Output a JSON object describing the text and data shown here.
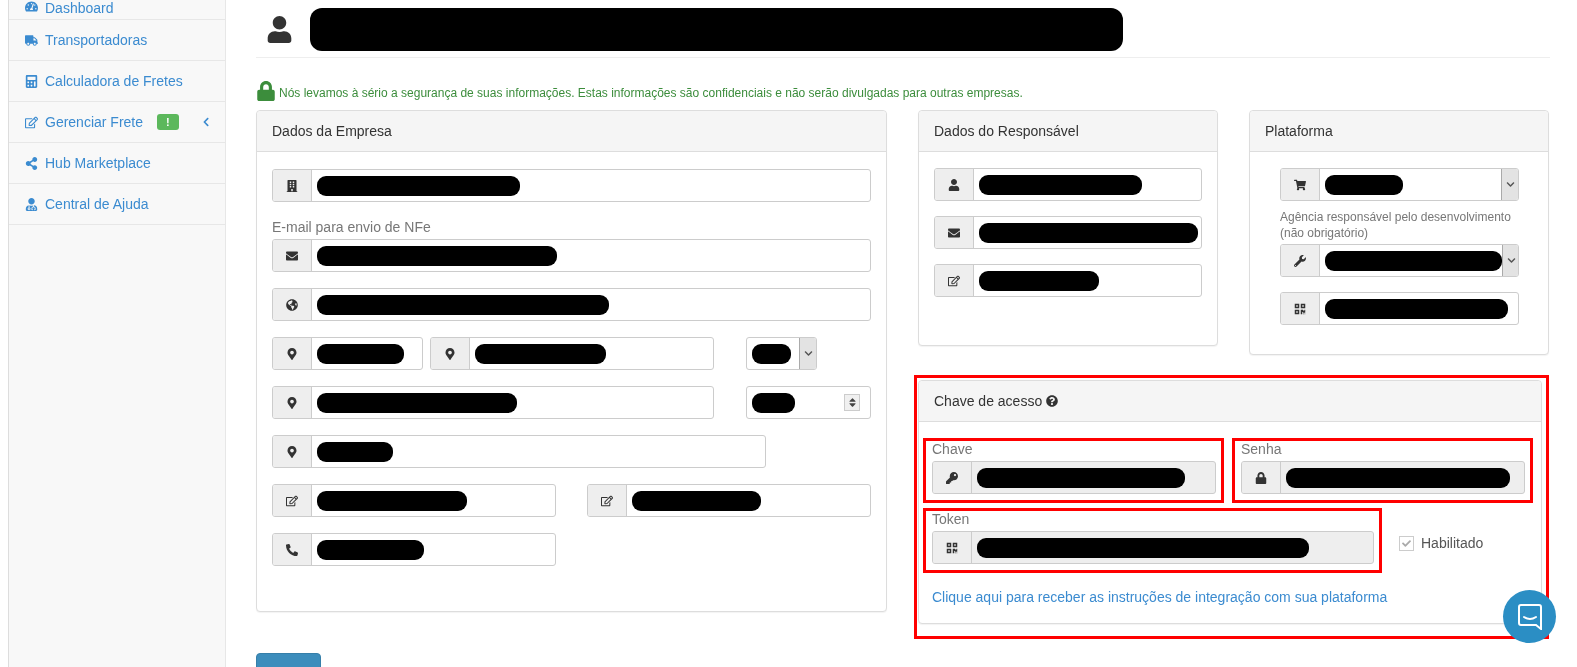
{
  "sidebar": {
    "items": [
      {
        "label": "Dashboard",
        "expandable": false
      },
      {
        "label": "Transportadoras",
        "expandable": false
      },
      {
        "label": "Calculadora de Fretes",
        "expandable": false
      },
      {
        "label": "Gerenciar Frete",
        "badge": "!",
        "expandable": true
      },
      {
        "label": "Hub Marketplace",
        "expandable": false
      },
      {
        "label": "Central de Ajuda",
        "expandable": false
      }
    ]
  },
  "notice": "Nós levamos à sério a segurança de suas informações. Estas informações são confidenciais e não serão divulgadas para outras empresas.",
  "company": {
    "title": "Dados da Empresa",
    "rows": [
      {
        "fields": [
          {
            "kind": "building"
          }
        ]
      },
      {
        "fields": [
          {
            "kind": "envelope",
            "label": "E-mail para envio de NFe"
          }
        ]
      },
      {
        "fields": [
          {
            "kind": "globe"
          }
        ]
      },
      {
        "fields": [
          {
            "kind": "pin"
          },
          {
            "kind": "pin"
          },
          {
            "kind": "select"
          }
        ]
      },
      {
        "fields": [
          {
            "kind": "pin"
          },
          {
            "kind": "spinner"
          }
        ]
      },
      {
        "fields": [
          {
            "kind": "pin"
          }
        ]
      },
      {
        "fields": [
          {
            "kind": "pencil"
          },
          {
            "kind": "pencil"
          }
        ]
      },
      {
        "fields": [
          {
            "kind": "phone"
          }
        ]
      }
    ]
  },
  "responsible": {
    "title": "Dados do Responsável",
    "rows": [
      {
        "fields": [
          {
            "kind": "user"
          }
        ]
      },
      {
        "fields": [
          {
            "kind": "envelope"
          }
        ]
      },
      {
        "fields": [
          {
            "kind": "pencil"
          }
        ]
      }
    ]
  },
  "platform": {
    "title": "Plataforma",
    "rows": [
      {
        "fields": [
          {
            "kind": "cart",
            "dropdown": true
          }
        ]
      },
      {
        "fields": [
          {
            "kind": "wrench",
            "dropdown": true,
            "label": "Agência responsável pelo desenvolvimento (não obrigatório)"
          }
        ]
      },
      {
        "fields": [
          {
            "kind": "qrcode"
          }
        ]
      }
    ]
  },
  "access_key": {
    "title": "Chave de acesso",
    "highlighted": true,
    "rows": [
      {
        "fields": [
          {
            "kind": "key",
            "label": "Chave",
            "disabled": true,
            "highlighted": true
          },
          {
            "kind": "lock",
            "label": "Senha",
            "disabled": true,
            "highlighted": true
          }
        ]
      },
      {
        "fields": [
          {
            "kind": "qrcode",
            "label": "Token",
            "disabled": true,
            "highlighted": true
          },
          {
            "kind": "checkbox",
            "label": "Habilitado",
            "checked": true,
            "disabled": true
          }
        ]
      }
    ],
    "link": "Clique aqui para receber as instruções de integração com sua plataforma"
  }
}
